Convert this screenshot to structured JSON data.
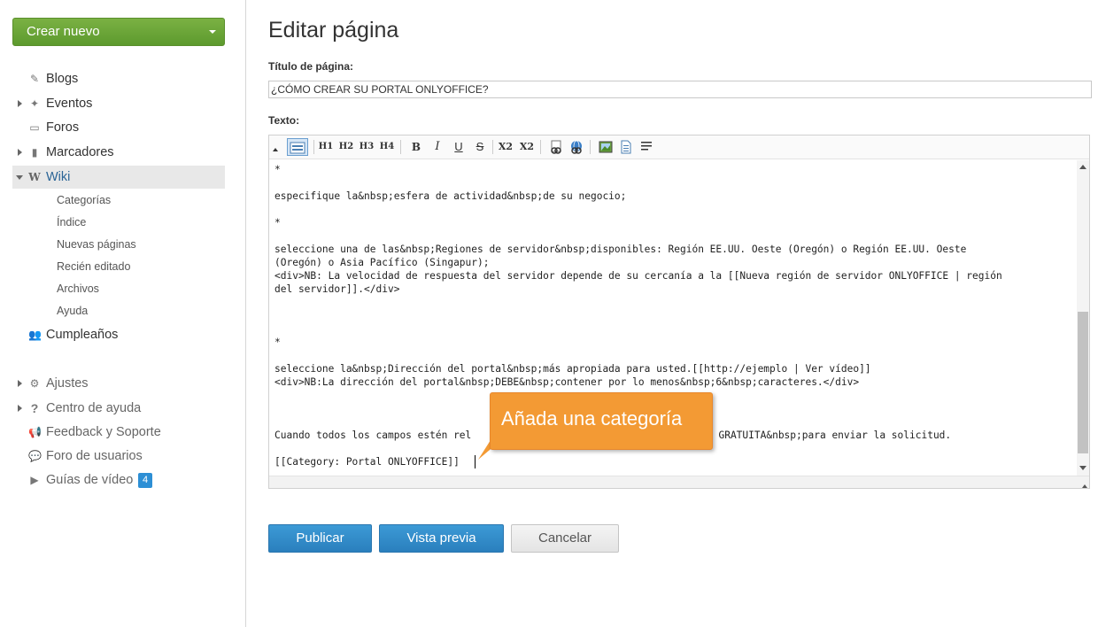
{
  "sidebar": {
    "create_label": "Crear nuevo",
    "items": [
      {
        "label": "Blogs"
      },
      {
        "label": "Eventos"
      },
      {
        "label": "Foros"
      },
      {
        "label": "Marcadores"
      },
      {
        "label": "Wiki"
      }
    ],
    "wiki_subitems": [
      "Categorías",
      "Índice",
      "Nuevas páginas",
      "Recién editado",
      "Archivos",
      "Ayuda"
    ],
    "birthdays": "Cumpleaños",
    "bottom": [
      {
        "label": "Ajustes"
      },
      {
        "label": "Centro de ayuda"
      },
      {
        "label": "Feedback y Soporte"
      },
      {
        "label": "Foro de usuarios"
      },
      {
        "label": "Guías de vídeo",
        "badge": "4"
      }
    ]
  },
  "main": {
    "title": "Editar página",
    "page_title_label": "Título de página:",
    "page_title_value": "¿CÓMO CREAR SU PORTAL ONLYOFFICE?",
    "text_label": "Texto:",
    "toolbar": [
      "H1",
      "H2",
      "H3",
      "H4",
      "B",
      "I",
      "U",
      "S",
      "X2",
      "X2"
    ],
    "text_lines": [
      "*",
      "especifique la&nbsp;esfera de actividad&nbsp;de su negocio;",
      "*",
      "seleccione una de las&nbsp;Regiones de servidor&nbsp;disponibles: Región EE.UU. Oeste (Oregón) o Región EE.UU. Oeste",
      "(Oregón) o Asia Pacífico (Singapur);",
      "<div>NB: La velocidad de respuesta del servidor depende de su cercanía a la [[Nueva región de servidor ONLYOFFICE | región",
      "del servidor]].</div>",
      "*",
      "seleccione la&nbsp;Dirección del portal&nbsp;más apropiada para usted.[[http://ejemplo | Ver vídeo]]",
      "<div>NB:La dirección del portal&nbsp;DEBE&nbsp;contener por lo menos&nbsp;6&nbsp;caracteres.</div>",
      "Cuando todos los campos estén rel",
      "A GRATUITA&nbsp;para enviar la solicitud.",
      "[[Category: Portal ONLYOFFICE]]"
    ],
    "callout": "Añada una categoría",
    "buttons": {
      "publish": "Publicar",
      "preview": "Vista previa",
      "cancel": "Cancelar"
    }
  },
  "colors": {
    "create_button": "#6aa63a",
    "primary_button": "#2f8bca",
    "callout": "#f39a34",
    "badge": "#2d8fd5",
    "active_item_bg": "#e8e8e8"
  }
}
